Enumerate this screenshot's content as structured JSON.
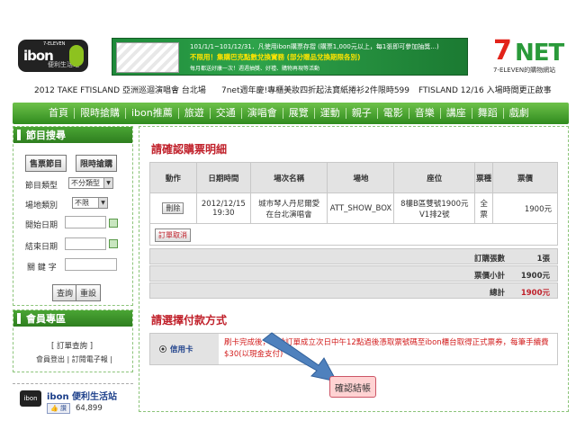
{
  "header": {
    "ibon_logo_text": "ibon",
    "ibon_logo_sub": "便利生活站",
    "ibon_logo_brand": "7-ELEVEN",
    "banner_line1": "101/1/1~101/12/31．凡使用ibon購票存摺 (購票1,000元以上，每1張即可參加抽獎...)",
    "banner_line2": "不限用！集購巴克點數兌換實務 (部分贈品兌換期限各別)",
    "banner_line3": "每月都送好康一次！週週抽獎、好禮、購物再現等活動",
    "net_logo": "NET",
    "net_logo_seven": "7",
    "net_caption": "7-ELEVEN的購物網站"
  },
  "news": [
    "2012 TAKE FTISLAND 亞洲巡迴演唱會 台北場",
    "7net週年慶!專櫃美妝四折起法寶紙捲衫2件限時599",
    "FTISLAND 12/16 入場時間更正啟事"
  ],
  "nav": [
    "首頁",
    "限時搶購",
    "ibon推薦",
    "旅遊",
    "交通",
    "演唱會",
    "展覽",
    "運動",
    "親子",
    "電影",
    "音樂",
    "講座",
    "舞蹈",
    "戲劇"
  ],
  "sidebar": {
    "search_title": "節目搜尋",
    "btn_sell": "售票節目",
    "btn_limited": "限時搶購",
    "type_label": "節目類型",
    "type_value": "不分類型",
    "venue_label": "場地類別",
    "venue_value": "不限",
    "start_label": "開始日期",
    "end_label": "結束日期",
    "keyword_label": "關 鍵 字",
    "query_btn": "查詢",
    "reset_btn": "重設",
    "member_title": "會員專區",
    "order_query": "[ 訂單查詢 ]",
    "member_links": "會員登出 | 訂閱電子報 |",
    "fb_name": "ibon 便利生活站",
    "fb_like": "讚",
    "fb_count": "64,899"
  },
  "confirm": {
    "title": "請確認購票明細",
    "headers": [
      "動作",
      "日期時間",
      "場次名稱",
      "場地",
      "座位",
      "票種",
      "票價"
    ],
    "row": {
      "action": "刪除",
      "date": "2012/12/15",
      "time": "19:30",
      "event1": "城市琴人丹尼爾愛",
      "event2": "在台北演唱會",
      "venue": "ATT_SHOW_BOX",
      "seat1": "8樓B區雙號1900元",
      "seat2": "V1排2號",
      "ticket1": "全",
      "ticket2": "票",
      "price": "1900元"
    },
    "cancel_btn": "訂單取消",
    "qty_label": "訂購張數",
    "qty_value": "1張",
    "subtotal_label": "票價小計",
    "subtotal_value": "1900元",
    "total_label": "總計",
    "total_value": "1900元"
  },
  "payment": {
    "title": "請選擇付款方式",
    "method": "信用卡",
    "notice": "刷卡完成後，請於訂單成立次日中午12點過後憑取票號碼至ibon櫃台取得正式票券，每筆手續費$30(以現金支付)",
    "confirm_btn": "確認結帳"
  },
  "colors": {
    "accent_green": "#3a9a28",
    "alert_red": "#c0202a",
    "arrow_blue": "#4f81bd"
  }
}
